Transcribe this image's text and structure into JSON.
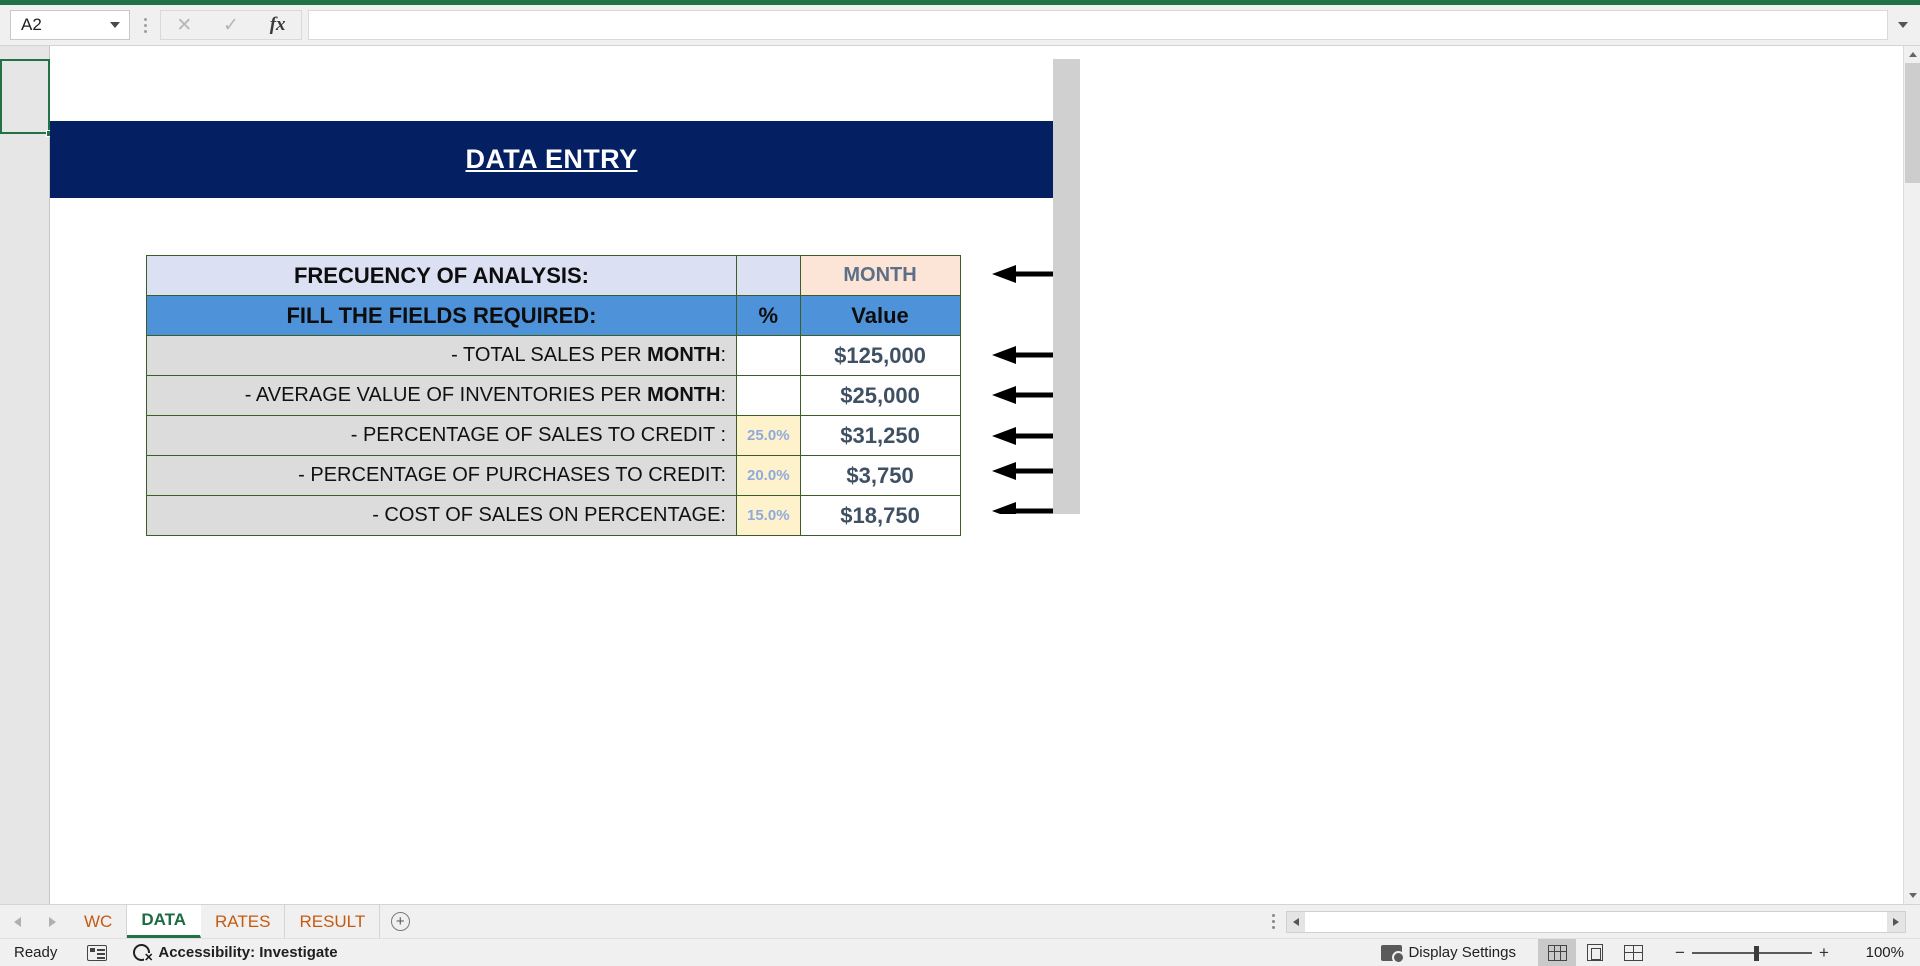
{
  "formula_bar": {
    "name_box_value": "A2",
    "cancel_icon": "close-icon",
    "confirm_icon": "check-icon",
    "function_icon": "fx-icon",
    "formula_value": ""
  },
  "card": {
    "banner_title": "DATA ENTRY"
  },
  "table": {
    "frequency_row": {
      "label": "FRECUENCY OF ANALYSIS:",
      "percent": "",
      "value": "MONTH"
    },
    "header_row": {
      "label": "FILL THE FIELDS REQUIRED:",
      "percent": "%",
      "value": "Value"
    },
    "rows": [
      {
        "label_prefix": "- TOTAL SALES PER ",
        "label_bold": "MONTH",
        "label_suffix": ":",
        "percent": "",
        "value": "$125,000"
      },
      {
        "label_prefix": "-  AVERAGE VALUE OF INVENTORIES PER ",
        "label_bold": "MONTH",
        "label_suffix": ":",
        "percent": "",
        "value": "$25,000"
      },
      {
        "label_prefix": "-  PERCENTAGE OF SALES TO CREDIT :",
        "label_bold": "",
        "label_suffix": "",
        "percent": "25.0%",
        "value": "$31,250"
      },
      {
        "label_prefix": "- PERCENTAGE OF PURCHASES TO CREDIT:",
        "label_bold": "",
        "label_suffix": "",
        "percent": "20.0%",
        "value": "$3,750"
      },
      {
        "label_prefix": "- COST OF SALES ON PERCENTAGE:",
        "label_bold": "",
        "label_suffix": "",
        "percent": "15.0%",
        "value": "$18,750"
      }
    ]
  },
  "sheet_tabs": {
    "prev_icon": "arrow-left-icon",
    "next_icon": "arrow-right-icon",
    "tabs": [
      {
        "label": "WC",
        "active": false
      },
      {
        "label": "DATA",
        "active": true
      },
      {
        "label": "RATES",
        "active": false
      },
      {
        "label": "RESULT",
        "active": false
      }
    ],
    "add_label": "+"
  },
  "status_bar": {
    "ready_text": "Ready",
    "macro_icon": "record-macro-icon",
    "accessibility_text": "Accessibility: Investigate",
    "accessibility_icon": "accessibility-icon",
    "display_settings_text": "Display Settings",
    "display_settings_icon": "monitor-icon",
    "view_normal_icon": "normal-view-icon",
    "view_layout_icon": "page-layout-icon",
    "view_break_icon": "page-break-icon",
    "zoom_out_label": "−",
    "zoom_in_label": "+",
    "zoom_level": "100%"
  },
  "colors": {
    "excel_green": "#217346",
    "banner_navy": "#042063",
    "header_blue": "#4e93d9",
    "freq_lavender": "#dbe1f2",
    "month_peach": "#fce4d6",
    "pct_cream": "#fdf2cc",
    "label_gray": "#dcdcdc",
    "border_green": "#3b5e25",
    "value_slate": "#3f5063"
  }
}
